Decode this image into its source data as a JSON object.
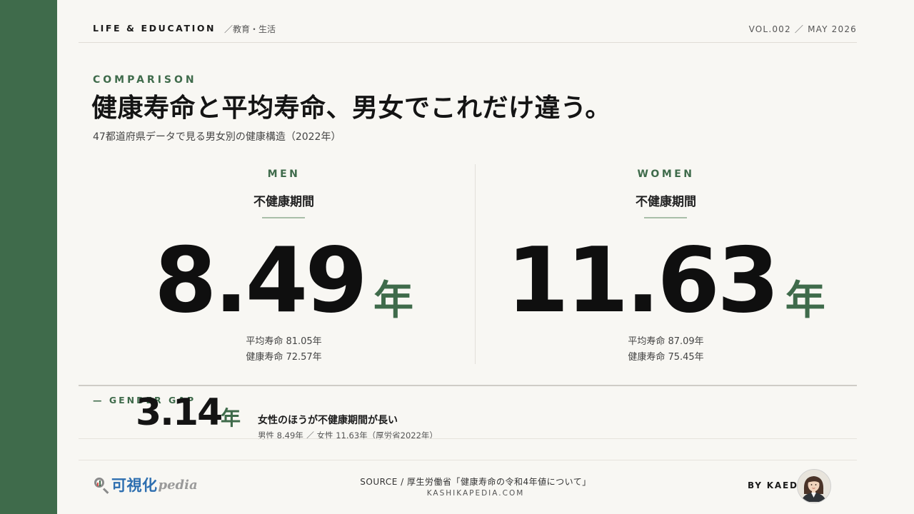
{
  "header": {
    "brand": "LIFE & EDUCATION",
    "category": "／教育・生活",
    "volume": "VOL.002 ／ MAY 2026"
  },
  "hero": {
    "eyebrow": "COMPARISON",
    "title": "健康寿命と平均寿命、男女でこれだけ違う。",
    "subtitle": "47都道府県データで見る男女別の健康構造（2022年）"
  },
  "panels": {
    "men": {
      "label": "MEN",
      "metric": "不健康期間",
      "value": "8.49",
      "unit": "年",
      "details": [
        "平均寿命 81.05年",
        "健康寿命 72.57年"
      ]
    },
    "women": {
      "label": "WOMEN",
      "metric": "不健康期間",
      "value": "11.63",
      "unit": "年",
      "details": [
        "平均寿命 87.09年",
        "健康寿命 75.45年"
      ]
    }
  },
  "gap": {
    "eyebrow": "— GENDER GAP",
    "value": "3.14",
    "unit": "年",
    "note": "女性のほうが不健康期間が長い",
    "source": "男性 8.49年 ／ 女性 11.63年（厚労省2022年）"
  },
  "footer": {
    "logo_jp": "可視化",
    "logo_en": "pedia",
    "source": "SOURCE / 厚生労働省「健康寿命の令和4年値について」",
    "site": "KASHIKAPEDIA.COM",
    "byline": "BY KAEDE",
    "logo_icon": "magnifier-chart-icon",
    "avatar_icon": "person-avatar"
  },
  "colors": {
    "accent": "#3f6b4b",
    "background": "#f8f7f3",
    "text": "#161616",
    "logo_blue": "#2e6fb0"
  }
}
